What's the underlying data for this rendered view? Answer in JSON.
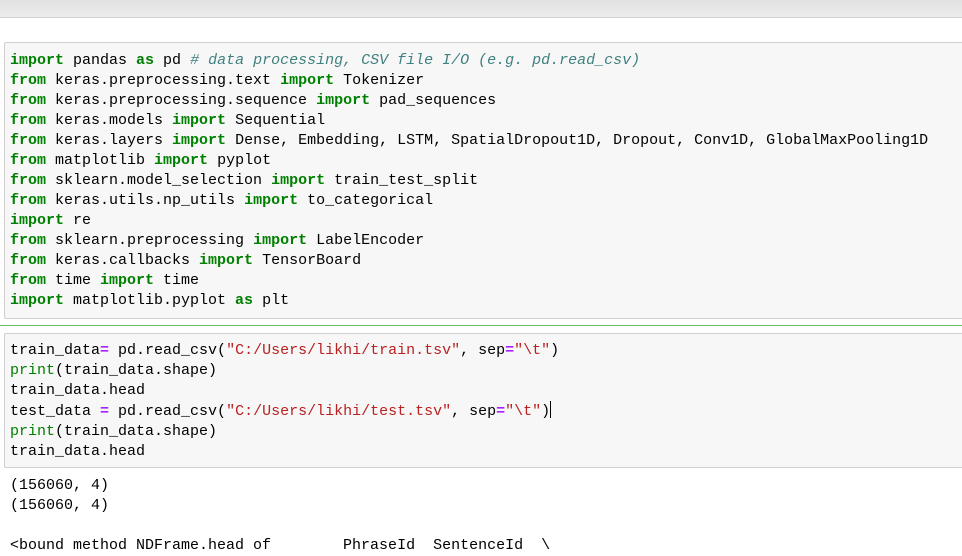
{
  "cell1": {
    "lines": [
      [
        [
          "kw",
          "import"
        ],
        [
          "t",
          " pandas "
        ],
        [
          "kw",
          "as"
        ],
        [
          "t",
          " pd "
        ],
        [
          "cm",
          "# data processing, CSV file I/O (e.g. pd.read_csv)"
        ]
      ],
      [
        [
          "kw",
          "from"
        ],
        [
          "t",
          " keras.preprocessing.text "
        ],
        [
          "kw",
          "import"
        ],
        [
          "t",
          " Tokenizer"
        ]
      ],
      [
        [
          "kw",
          "from"
        ],
        [
          "t",
          " keras.preprocessing.sequence "
        ],
        [
          "kw",
          "import"
        ],
        [
          "t",
          " pad_sequences"
        ]
      ],
      [
        [
          "kw",
          "from"
        ],
        [
          "t",
          " keras.models "
        ],
        [
          "kw",
          "import"
        ],
        [
          "t",
          " Sequential"
        ]
      ],
      [
        [
          "kw",
          "from"
        ],
        [
          "t",
          " keras.layers "
        ],
        [
          "kw",
          "import"
        ],
        [
          "t",
          " Dense, Embedding, LSTM, SpatialDropout1D, Dropout, Conv1D, GlobalMaxPooling1D"
        ]
      ],
      [
        [
          "kw",
          "from"
        ],
        [
          "t",
          " matplotlib "
        ],
        [
          "kw",
          "import"
        ],
        [
          "t",
          " pyplot"
        ]
      ],
      [
        [
          "kw",
          "from"
        ],
        [
          "t",
          " sklearn.model_selection "
        ],
        [
          "kw",
          "import"
        ],
        [
          "t",
          " train_test_split"
        ]
      ],
      [
        [
          "kw",
          "from"
        ],
        [
          "t",
          " keras.utils.np_utils "
        ],
        [
          "kw",
          "import"
        ],
        [
          "t",
          " to_categorical"
        ]
      ],
      [
        [
          "kw",
          "import"
        ],
        [
          "t",
          " re"
        ]
      ],
      [
        [
          "kw",
          "from"
        ],
        [
          "t",
          " sklearn.preprocessing "
        ],
        [
          "kw",
          "import"
        ],
        [
          "t",
          " LabelEncoder"
        ]
      ],
      [
        [
          "kw",
          "from"
        ],
        [
          "t",
          " keras.callbacks "
        ],
        [
          "kw",
          "import"
        ],
        [
          "t",
          " TensorBoard"
        ]
      ],
      [
        [
          "kw",
          "from"
        ],
        [
          "t",
          " time "
        ],
        [
          "kw",
          "import"
        ],
        [
          "t",
          " time"
        ]
      ],
      [
        [
          "kw",
          "import"
        ],
        [
          "t",
          " matplotlib.pyplot "
        ],
        [
          "kw",
          "as"
        ],
        [
          "t",
          " plt"
        ]
      ]
    ]
  },
  "cell2": {
    "lines": [
      [
        [
          "t",
          "train_data"
        ],
        [
          "op",
          "="
        ],
        [
          "t",
          " pd.read_csv("
        ],
        [
          "st",
          "\"C:/Users/likhi/train.tsv\""
        ],
        [
          "t",
          ", sep"
        ],
        [
          "op",
          "="
        ],
        [
          "st",
          "\"\\t\""
        ],
        [
          "t",
          ")"
        ]
      ],
      [
        [
          "bi",
          "print"
        ],
        [
          "t",
          "(train_data.shape)"
        ]
      ],
      [
        [
          "t",
          "train_data.head"
        ]
      ],
      [
        [
          "t",
          "test_data "
        ],
        [
          "op",
          "="
        ],
        [
          "t",
          " pd.read_csv("
        ],
        [
          "st",
          "\"C:/Users/likhi/test.tsv\""
        ],
        [
          "t",
          ", sep"
        ],
        [
          "op",
          "="
        ],
        [
          "st",
          "\"\\t\""
        ],
        [
          "t",
          ")"
        ],
        [
          "cursor",
          ""
        ]
      ],
      [
        [
          "bi",
          "print"
        ],
        [
          "t",
          "(train_data.shape)"
        ]
      ],
      [
        [
          "t",
          "train_data.head"
        ]
      ]
    ]
  },
  "output": {
    "lines": [
      "(156060, 4)",
      "(156060, 4)",
      "",
      "<bound method NDFrame.head of        PhraseId  SentenceId  \\"
    ]
  }
}
